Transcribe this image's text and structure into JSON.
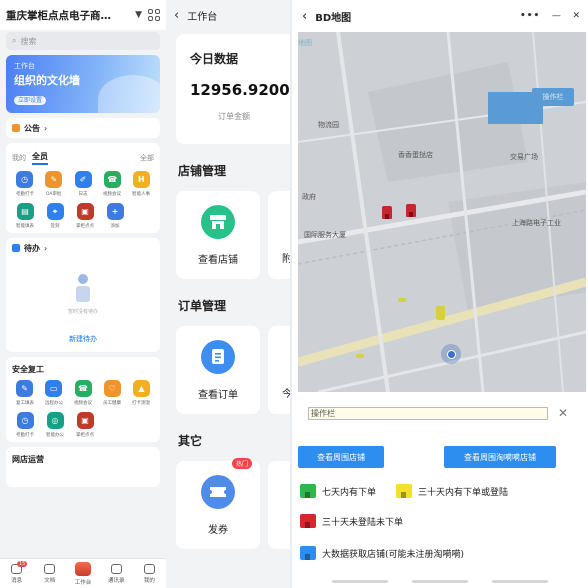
{
  "panel1": {
    "org_name": "重庆掌柜点点电子商…",
    "search_placeholder": "搜索",
    "banner": {
      "small": "工作台",
      "big": "组织的文化墙",
      "pill": "立即设置"
    },
    "notice_label": "公告",
    "apps_tabs": [
      "我的",
      "全员"
    ],
    "apps_more": "全部",
    "apps_row1": [
      {
        "label": "考勤打卡",
        "color": "#3d7be0",
        "glyph": "◷"
      },
      {
        "label": "OA审批",
        "color": "#f0932b",
        "glyph": "✎"
      },
      {
        "label": "日志",
        "color": "#2f80ed",
        "glyph": "✐"
      },
      {
        "label": "视频会议",
        "color": "#27ae60",
        "glyph": "☎"
      },
      {
        "label": "智能人事",
        "color": "#f2b01e",
        "glyph": "H"
      }
    ],
    "apps_row2": [
      {
        "label": "智能填表",
        "color": "#16a085",
        "glyph": "▤"
      },
      {
        "label": "签到",
        "color": "#2f80ed",
        "glyph": "⌖"
      },
      {
        "label": "掌柜点点",
        "color": "#c0392b",
        "glyph": "▣"
      },
      {
        "label": "添加",
        "color": "#3d7be0",
        "glyph": "+"
      }
    ],
    "todo_label": "待办",
    "todo_sub": "暂时没有待办",
    "todo_link": "新建待办",
    "section2_title": "安全复工",
    "apps_row3": [
      {
        "label": "复工填表",
        "color": "#3d7be0",
        "glyph": "✎"
      },
      {
        "label": "远程办公",
        "color": "#2f80ed",
        "glyph": "▭"
      },
      {
        "label": "视频会议",
        "color": "#27ae60",
        "glyph": "☎"
      },
      {
        "label": "员工健康",
        "color": "#f0932b",
        "glyph": "♡"
      },
      {
        "label": "打卡测温",
        "color": "#f2b01e",
        "glyph": "▲"
      }
    ],
    "apps_row4": [
      {
        "label": "考勤打卡",
        "color": "#3d7be0",
        "glyph": "◷"
      },
      {
        "label": "智能办公",
        "color": "#16a085",
        "glyph": "◎"
      },
      {
        "label": "掌柜点点",
        "color": "#c0392b",
        "glyph": "▣"
      }
    ],
    "section3_title": "网店运营",
    "tabbar": [
      {
        "label": "消息",
        "badge": "15"
      },
      {
        "label": "文档",
        "badge": ""
      },
      {
        "label": "工作台",
        "badge": ""
      },
      {
        "label": "通讯录",
        "badge": ""
      },
      {
        "label": "我的",
        "badge": ""
      }
    ]
  },
  "panel2": {
    "nav_title": "工作台",
    "today_title": "今日数据",
    "amount": "12956.9200000",
    "amount_label": "订单金额",
    "shop_section": "店铺管理",
    "shop_tile": "查看店铺",
    "shop_tile2_partial": "附",
    "order_section": "订单管理",
    "order_tile": "查看订单",
    "order_tile2_partial": "今",
    "other_section": "其它",
    "other_tile": "发券",
    "other_badge": "热门"
  },
  "panel3": {
    "nav_title": "BD地图",
    "map_tab": "地图",
    "map_button": "操作栏",
    "map_labels": [
      "物流园",
      "香香蛋挞店",
      "交易广场",
      "上海路电子工业",
      "国际服务大厦",
      "政府"
    ],
    "operate_value": "操作栏",
    "btn_nearby": "查看周围店铺",
    "btn_tao": "查看周围淘嗬嗬店铺",
    "legend": [
      {
        "text": "七天内有下单",
        "color": "#2db84d"
      },
      {
        "text": "三十天内有下单或登陆",
        "color": "#f2e12a"
      },
      {
        "text": "三十天未登陆未下单",
        "color": "#d7262d"
      },
      {
        "text": "大数据获取店铺(可能未注册淘嗬嗬)",
        "color": "#2e8ef0"
      }
    ]
  }
}
